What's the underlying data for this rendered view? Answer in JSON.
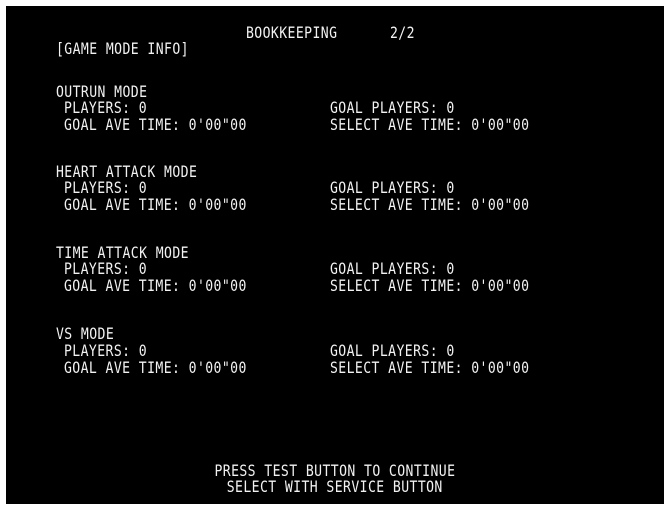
{
  "header": {
    "title": "BOOKKEEPING",
    "page": "2/2",
    "section": "[GAME MODE INFO]"
  },
  "modes": [
    {
      "name": "OUTRUN MODE",
      "players": "PLAYERS: 0",
      "goal_players": "GOAL PLAYERS: 0",
      "goal_ave_time": "GOAL AVE TIME: 0'00\"00",
      "select_ave_time": "SELECT AVE TIME: 0'00\"00"
    },
    {
      "name": "HEART ATTACK MODE",
      "players": "PLAYERS: 0",
      "goal_players": "GOAL PLAYERS: 0",
      "goal_ave_time": "GOAL AVE TIME: 0'00\"00",
      "select_ave_time": "SELECT AVE TIME: 0'00\"00"
    },
    {
      "name": "TIME ATTACK MODE",
      "players": "PLAYERS: 0",
      "goal_players": "GOAL PLAYERS: 0",
      "goal_ave_time": "GOAL AVE TIME: 0'00\"00",
      "select_ave_time": "SELECT AVE TIME: 0'00\"00"
    },
    {
      "name": "VS MODE",
      "players": "PLAYERS: 0",
      "goal_players": "GOAL PLAYERS: 0",
      "goal_ave_time": "GOAL AVE TIME: 0'00\"00",
      "select_ave_time": "SELECT AVE TIME: 0'00\"00"
    }
  ],
  "footer": {
    "line1": "PRESS TEST BUTTON TO CONTINUE",
    "line2": "SELECT WITH SERVICE BUTTON"
  }
}
